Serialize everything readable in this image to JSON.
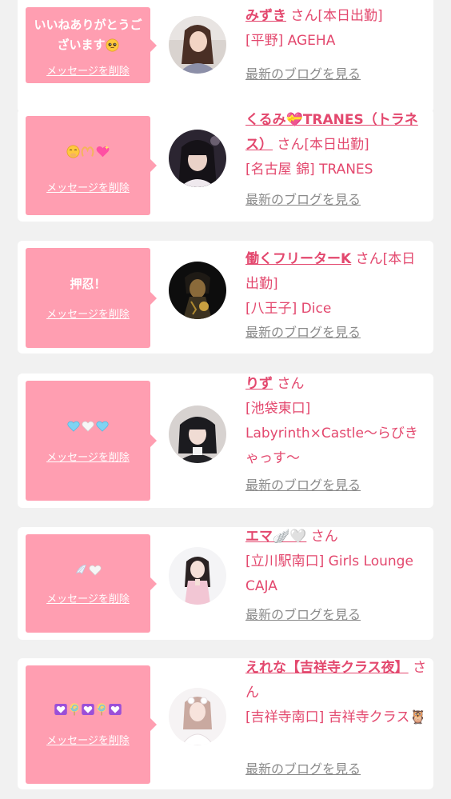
{
  "colors": {
    "accent": "#e3486e",
    "bubble": "#ff9eb1",
    "page_bg": "#f1f1f1",
    "card_bg": "#ffffff",
    "link_gray": "#8a8a8a"
  },
  "delete_label": "メッセージを削除",
  "blog_label": "最新のブログを見る",
  "san_label": "さん",
  "cards": [
    {
      "message": "いいねありがとうございます",
      "message_emoji": [
        "pleading-face-emoji"
      ],
      "name": "みずき",
      "status": "[本日出勤]",
      "shop": "[平野] AGEHA"
    },
    {
      "message": "",
      "message_emoji": [
        "face-with-hand-emoji",
        "heart-hands-emoji",
        "sparkling-heart-emoji"
      ],
      "name": "くるみ💝TRANES（トラネス）",
      "status": "[本日出勤]",
      "shop": "[名古屋 錦] TRANES"
    },
    {
      "message": "押忍！",
      "message_emoji": [],
      "name": "働くフリーターK",
      "status": "[本日出勤]",
      "shop": "[八王子] Dice"
    },
    {
      "message": "",
      "message_emoji": [
        "light-blue-heart-emoji",
        "white-heart-emoji",
        "light-blue-heart-emoji"
      ],
      "name": "りず",
      "status": "",
      "shop": "[池袋東口] Labyrinth×Castle〜らびきゃっす〜"
    },
    {
      "message": "",
      "message_emoji": [
        "wing-emoji",
        "white-heart-emoji"
      ],
      "name": "エマ🪽🤍",
      "status": "",
      "shop": "[立川駅南口] Girls Lounge CAJA"
    },
    {
      "message": "",
      "message_emoji": [
        "purple-heart-emoji",
        "lollipop-emoji",
        "purple-heart-emoji",
        "lollipop-emoji",
        "purple-heart-emoji"
      ],
      "name": "えれな【吉祥寺クラス夜】",
      "status": "",
      "shop": "[吉祥寺南口] 吉祥寺クラス🦉"
    }
  ]
}
